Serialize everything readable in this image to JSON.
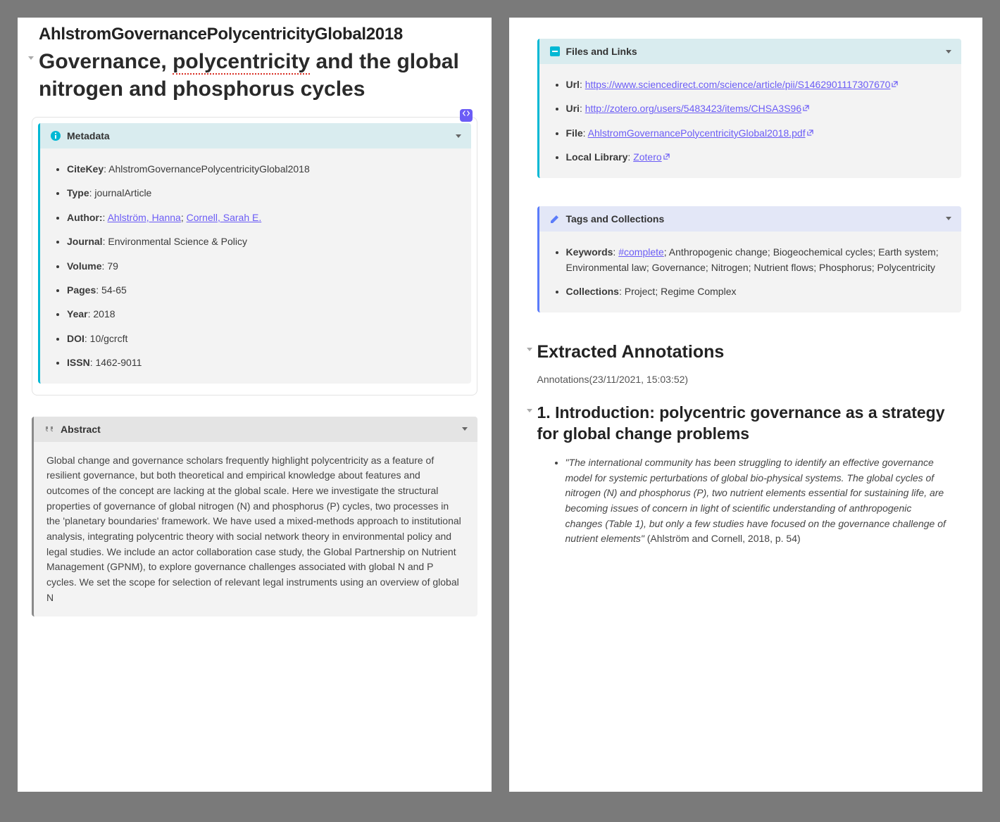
{
  "citekey_raw": "AhlstromGovernancePolycentricityGlobal2018",
  "title_parts": {
    "a": "Governance, ",
    "b": "polycentricity",
    "c": " and the global nitrogen and phosphorus cycles"
  },
  "metadata": {
    "header": "Metadata",
    "citekey_label": "CiteKey",
    "citekey": "AhlstromGovernancePolycentricityGlobal2018",
    "type_label": "Type",
    "type": "journalArticle",
    "author_label": "Author:",
    "author1": "Ahlström, Hanna",
    "author2": "Cornell, Sarah E.",
    "journal_label": "Journal",
    "journal": "Environmental Science & Policy",
    "volume_label": "Volume",
    "volume": "79",
    "pages_label": "Pages",
    "pages": "54-65",
    "year_label": "Year",
    "year": "2018",
    "doi_label": "DOI",
    "doi": "10/gcrcft",
    "issn_label": "ISSN",
    "issn": "1462-9011"
  },
  "abstract": {
    "header": "Abstract",
    "text": "Global change and governance scholars frequently highlight polycentricity as a feature of resilient governance, but both theoretical and empirical knowledge about features and outcomes of the concept are lacking at the global scale. Here we investigate the structural properties of governance of global nitrogen (N) and phosphorus (P) cycles, two processes in the 'planetary boundaries' framework. We have used a mixed-methods approach to institutional analysis, integrating polycentric theory with social network theory in environmental policy and legal studies. We include an actor collaboration case study, the Global Partnership on Nutrient Management (GPNM), to explore governance challenges associated with global N and P cycles. We set the scope for selection of relevant legal instruments using an overview of global N"
  },
  "files": {
    "header": "Files and Links",
    "url_label": "Url",
    "url_text": "https://www.sciencedirect.com/science/article/pii/S1462901117307670",
    "uri_label": "Uri",
    "uri_text": "http://zotero.org/users/5483423/items/CHSA3S96",
    "file_label": "File",
    "file_text": "AhlstromGovernancePolycentricityGlobal2018.pdf",
    "local_label": "Local Library",
    "local_text": "Zotero"
  },
  "tags": {
    "header": "Tags and Collections",
    "keywords_label": "Keywords",
    "keywords_link": "#complete",
    "keywords_rest": "; Anthropogenic change; Biogeochemical cycles; Earth system; Environmental law; Governance; Nitrogen; Nutrient flows; Phosphorus; Polycentricity",
    "collections_label": "Collections",
    "collections": "Project; Regime Complex"
  },
  "annotations": {
    "heading": "Extracted Annotations",
    "subnote": "Annotations(23/11/2021, 15:03:52)",
    "intro_heading": "1. Introduction: polycentric governance as a strategy for global change problems",
    "quote": "\"The international community has been struggling to identify an effective governance model for systemic perturbations of global bio-physical systems. The global cycles of nitrogen (N) and phosphorus (P), two nutrient elements essential for sustaining life, are becoming issues of concern in light of scientific understanding of anthropogenic changes (Table 1), but only a few studies have focused on the governance challenge of nutrient elements\"",
    "cite": " (Ahlström and Cornell, 2018, p. 54)"
  }
}
